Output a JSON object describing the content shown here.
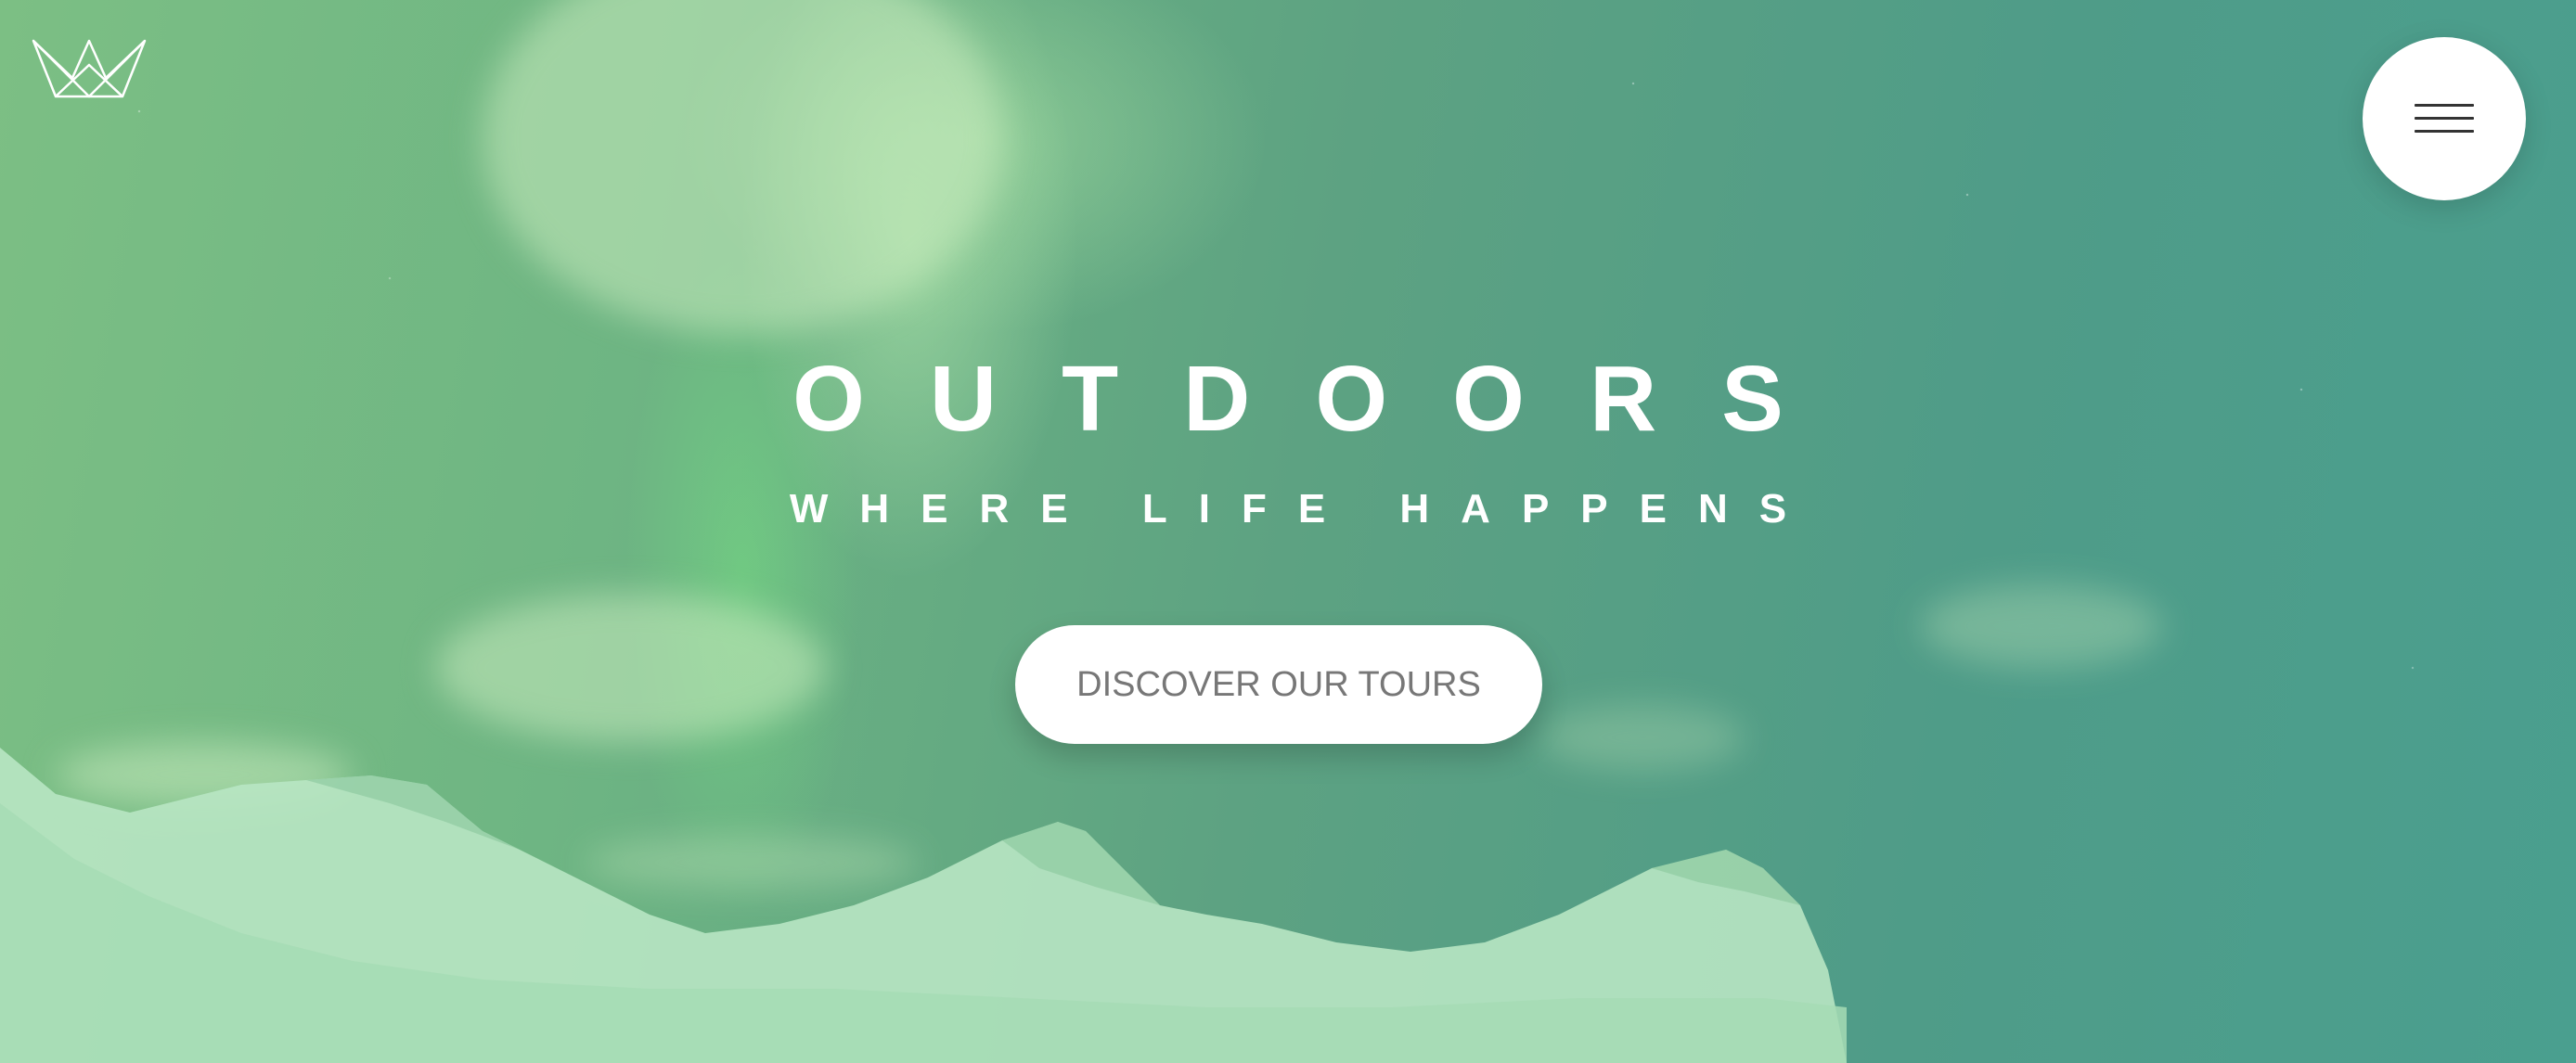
{
  "hero": {
    "title": "OUTDOORS",
    "subtitle": "WHERE LIFE HAPPENS",
    "cta_label": "DISCOVER OUR TOURS"
  },
  "header": {
    "logo_icon": "crown-logo-icon",
    "menu_icon": "hamburger-menu-icon"
  },
  "colors": {
    "overlay_start": "#7cbf84",
    "overlay_end": "#4a9f8f",
    "text": "#ffffff",
    "cta_background": "#ffffff",
    "cta_text": "#777777"
  }
}
